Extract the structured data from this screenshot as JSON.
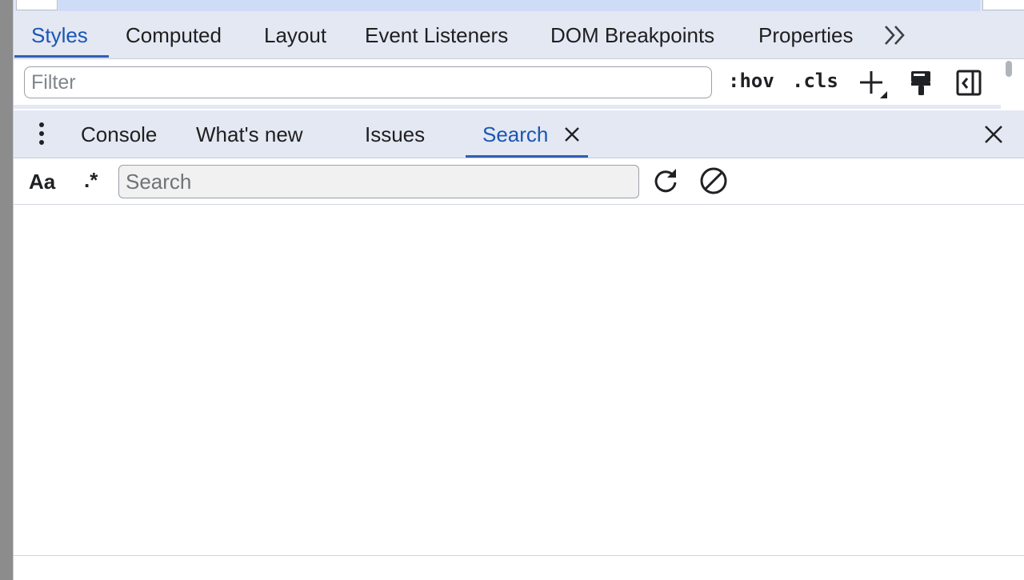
{
  "sidebar_tabs": [
    {
      "label": "Styles",
      "active": true
    },
    {
      "label": "Computed",
      "active": false
    },
    {
      "label": "Layout",
      "active": false
    },
    {
      "label": "Event Listeners",
      "active": false
    },
    {
      "label": "DOM Breakpoints",
      "active": false
    },
    {
      "label": "Properties",
      "active": false
    }
  ],
  "more_tabs_icon": "double-chevron-right-icon",
  "styles_toolbar": {
    "filter_placeholder": "Filter",
    "hov_label": ":hov",
    "cls_label": ".cls",
    "icons": [
      "new-style-rule-icon",
      "paint-format-icon",
      "toggle-sidebar-icon"
    ]
  },
  "drawer": {
    "menu_icon": "more-vertical-icon",
    "tabs": [
      {
        "label": "Console",
        "active": false
      },
      {
        "label": "What's new",
        "active": false
      },
      {
        "label": "Issues",
        "active": false
      },
      {
        "label": "Search",
        "active": true,
        "closable": true
      }
    ],
    "close_icon": "close-icon"
  },
  "search_toolbar": {
    "match_case_label": "Aa",
    "regex_label": ".*",
    "search_placeholder": "Search",
    "search_value": "",
    "icons": [
      "refresh-icon",
      "clear-icon"
    ]
  },
  "colors": {
    "tab_bar_bg": "#e4e8f3",
    "active_tab_text": "#1a56b3",
    "active_tab_underline": "#2f5fb7",
    "highlight_row": "#cfdcf7"
  }
}
